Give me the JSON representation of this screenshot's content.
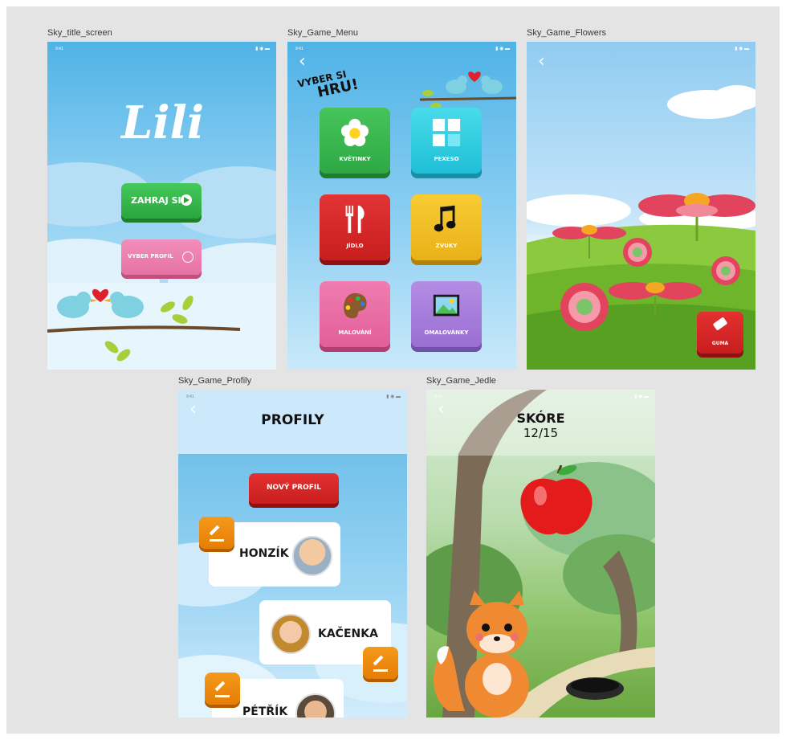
{
  "frames": {
    "title": {
      "label": "Sky_title_screen",
      "status_time": "9:41",
      "logo_text": "Lili",
      "play_button": "ZAHRAJ SI",
      "profile_button": "VYBER PROFIL"
    },
    "menu": {
      "label": "Sky_Game_Menu",
      "status_time": "9:41",
      "heading_line1": "VYBER SI",
      "heading_line2": "HRU!",
      "tiles": [
        {
          "label": "KVĚTINKY",
          "color": "#37b64a",
          "icon": "flower-icon"
        },
        {
          "label": "PEXESO",
          "color": "#2fd0e2",
          "icon": "grid-icon"
        },
        {
          "label": "JÍDLO",
          "color": "#d62828",
          "icon": "cutlery-icon"
        },
        {
          "label": "ZVUKY",
          "color": "#f2bf22",
          "icon": "music-note-icon"
        },
        {
          "label": "MALOVÁNÍ",
          "color": "#e868a0",
          "icon": "palette-icon"
        },
        {
          "label": "OMALOVÁNKY",
          "color": "#a87fdc",
          "icon": "picture-icon"
        }
      ]
    },
    "flowers": {
      "label": "Sky_Game_Flowers",
      "eraser_button": "GUMA"
    },
    "profiles": {
      "label": "Sky_Game_Profily",
      "status_time": "9:41",
      "title": "PROFILY",
      "new_profile_button": "NOVÝ PROFIL",
      "profiles": [
        {
          "name": "HONZÍK"
        },
        {
          "name": "KAČENKA"
        },
        {
          "name": "PÉTŘÍK"
        }
      ]
    },
    "apple": {
      "label": "Sky_Game_Jedle",
      "status_time": "9:41",
      "score_label": "SKÓRE",
      "score_value": "12/15"
    }
  },
  "colors": {
    "canvas": "#e4e4e4",
    "sky": "#5ab7e8",
    "green_btn": "#2fb84a",
    "pink_btn": "#ee7fb0",
    "red_btn": "#d92626",
    "orange_edit": "#f08a10"
  }
}
